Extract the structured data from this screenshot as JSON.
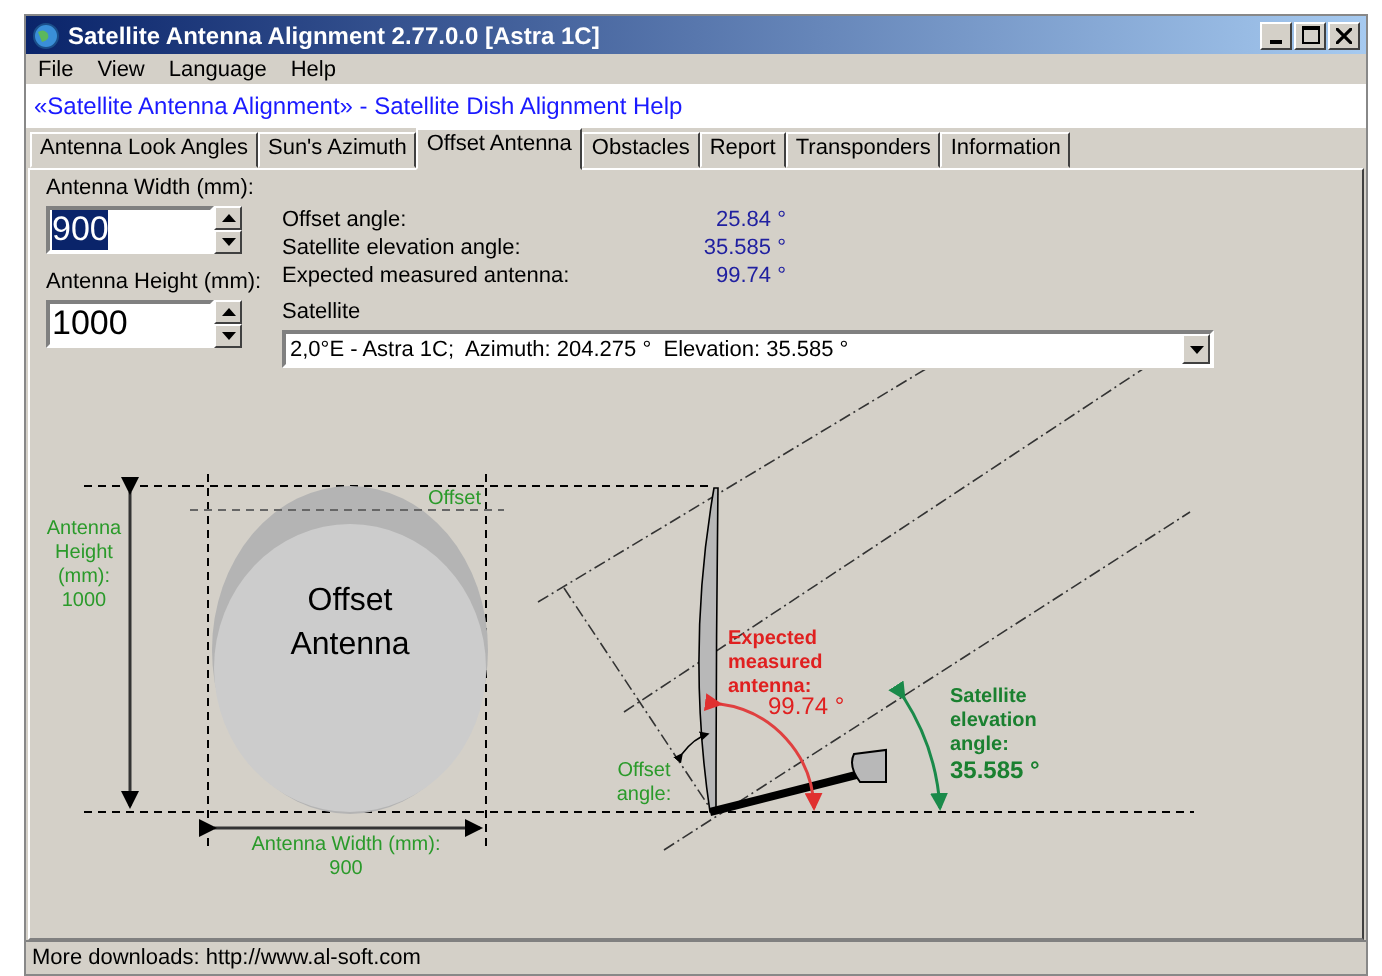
{
  "window": {
    "title": "Satellite Antenna Alignment 2.77.0.0 [Astra 1C]"
  },
  "menu": [
    "File",
    "View",
    "Language",
    "Help"
  ],
  "link": "«Satellite Antenna Alignment» - Satellite Dish Alignment Help",
  "tabs": [
    {
      "label": "Antenna Look Angles",
      "selected": false
    },
    {
      "label": "Sun's Azimuth",
      "selected": false
    },
    {
      "label": "Offset Antenna",
      "selected": true
    },
    {
      "label": "Obstacles",
      "selected": false
    },
    {
      "label": "Report",
      "selected": false
    },
    {
      "label": "Transponders",
      "selected": false
    },
    {
      "label": "Information",
      "selected": false
    }
  ],
  "inputs": [
    {
      "label": "Antenna Width (mm):",
      "value": "900",
      "selected": true
    },
    {
      "label": "Antenna Height (mm):",
      "value": "1000",
      "selected": false
    }
  ],
  "results": [
    {
      "label": "Offset angle:",
      "value": "25.84 °"
    },
    {
      "label": "Satellite elevation angle:",
      "value": "35.585 °"
    },
    {
      "label": "Expected measured antenna:",
      "value": "99.74 °"
    }
  ],
  "satellite": {
    "label": "Satellite",
    "value": "2,0°E - Astra 1C;  Azimuth: 204.275 °  Elevation: 35.585 °"
  },
  "diagram": {
    "title": [
      "Offset",
      "Antenna"
    ],
    "offset_label": "Offset",
    "height_label": [
      "Antenna",
      "Height",
      "(mm):",
      "1000"
    ],
    "width_label": [
      "Antenna Width (mm):",
      "900"
    ],
    "offset_angle_label": [
      "Offset",
      "angle:"
    ],
    "expected_label": [
      "Expected",
      "measured",
      "antenna:"
    ],
    "expected_value": "99.74 °",
    "elevation_label": [
      "Satellite",
      "elevation",
      "angle:"
    ],
    "elevation_value": "35.585 °"
  },
  "status_bar": "More downloads: http://www.al-soft.com"
}
